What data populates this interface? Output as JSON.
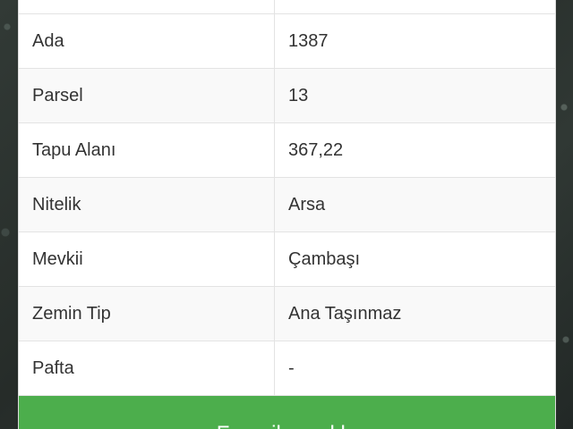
{
  "parcel_info": {
    "rows": [
      {
        "label": "Ada",
        "value": "1387"
      },
      {
        "label": "Parsel",
        "value": "13"
      },
      {
        "label": "Tapu Alanı",
        "value": "367,22"
      },
      {
        "label": "Nitelik",
        "value": "Arsa"
      },
      {
        "label": "Mevkii",
        "value": "Çambaşı"
      },
      {
        "label": "Zemin Tip",
        "value": "Ana Taşınmaz"
      },
      {
        "label": "Pafta",
        "value": "-"
      }
    ]
  },
  "action": {
    "label": "Favorilere ekle"
  },
  "colors": {
    "button_green": "#4cae4c",
    "text": "#333333",
    "row_alt": "#f9f9f9"
  }
}
